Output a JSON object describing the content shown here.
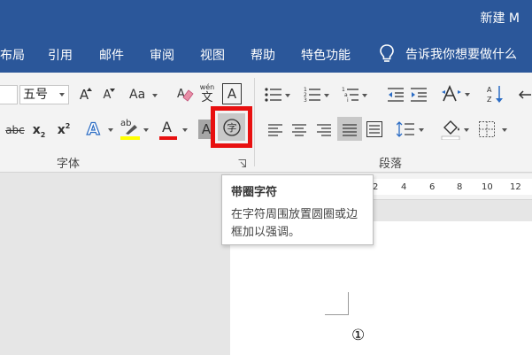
{
  "window": {
    "title": "新建 M"
  },
  "tabs": [
    {
      "label": "布局"
    },
    {
      "label": "引用"
    },
    {
      "label": "邮件"
    },
    {
      "label": "审阅"
    },
    {
      "label": "视图"
    },
    {
      "label": "帮助"
    },
    {
      "label": "特色功能"
    }
  ],
  "tell_me": {
    "label": "告诉我你想要做什么"
  },
  "font_group": {
    "label": "字体",
    "font_size": "五号",
    "grow_font": "A",
    "shrink_font": "A",
    "change_case": "Aa",
    "phonetic_top": "wén",
    "phonetic_bottom": "文",
    "char_border": "A",
    "strikethrough": "abc",
    "subscript": "x",
    "subscript_mark": "2",
    "superscript": "x",
    "superscript_mark": "2",
    "text_effect": "A",
    "highlight": "ab",
    "font_color": "A",
    "char_shading": "A",
    "enclose_char": "字",
    "colors": {
      "highlight": "#ffff00",
      "font_color": "#e81010",
      "highlight_box": "#e81010"
    }
  },
  "paragraph_group": {
    "label": "段落"
  },
  "tooltip": {
    "title": "带圈字符",
    "description": "在字符周围放置圆圈或边框加以强调。"
  },
  "ruler": {
    "numbers": [
      "2",
      "4",
      "6",
      "8",
      "10",
      "12"
    ]
  },
  "document": {
    "content": "①"
  }
}
